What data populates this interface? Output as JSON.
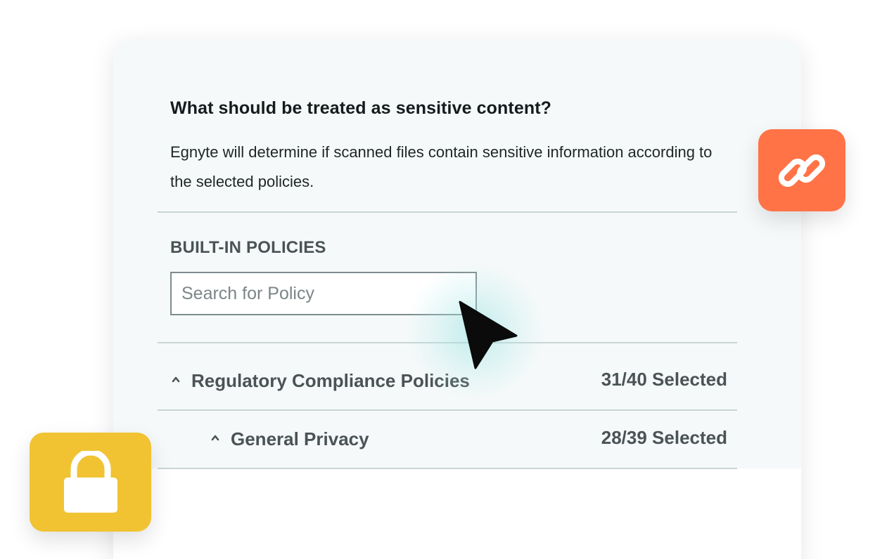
{
  "dialog": {
    "question": "What should be treated as sensitive content?",
    "description": "Egnyte will determine if scanned files contain sensitive information according to the selected policies."
  },
  "policies": {
    "heading": "BUILT-IN POLICIES",
    "search": {
      "placeholder": "Search for Policy",
      "value": ""
    },
    "groups": [
      {
        "label": "Regulatory Compliance Policies",
        "count": "31/40 Selected",
        "expanded": true
      },
      {
        "label": "General Privacy",
        "count": "28/39 Selected",
        "expanded": true
      }
    ]
  },
  "badges": {
    "link": {
      "icon": "link-icon",
      "color": "#ff7347"
    },
    "lock": {
      "icon": "lock-icon",
      "color": "#f1c333"
    }
  },
  "cursor": {
    "icon": "pointer-cursor-icon",
    "glow_color": "#96e2e2"
  }
}
